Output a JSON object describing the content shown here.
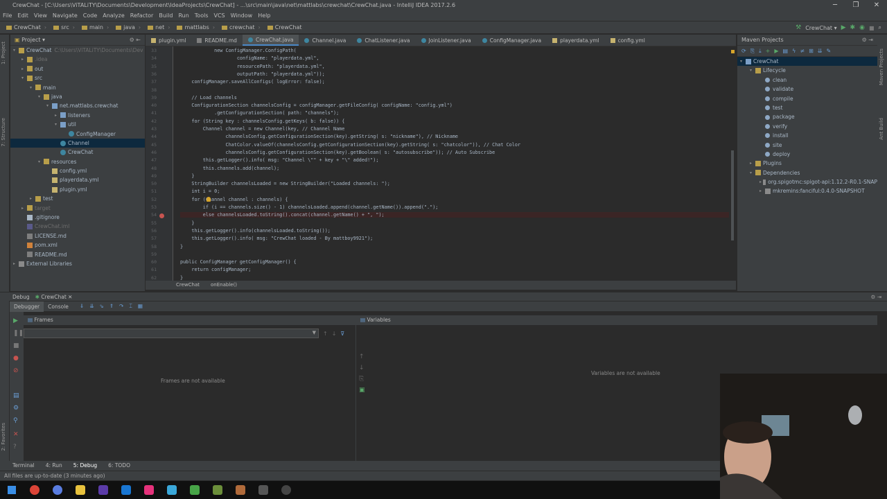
{
  "window": {
    "title": "CrewChat - [C:\\Users\\ViTALiTY\\Documents\\Development\\IdeaProjects\\CrewChat] - ...\\src\\main\\java\\net\\mattlabs\\crewchat\\CrewChat.java - IntelliJ IDEA 2017.2.6"
  },
  "menu": [
    "File",
    "Edit",
    "View",
    "Navigate",
    "Code",
    "Analyze",
    "Refactor",
    "Build",
    "Run",
    "Tools",
    "VCS",
    "Window",
    "Help"
  ],
  "nav": {
    "crumbs": [
      "CrewChat",
      "src",
      "main",
      "java",
      "net",
      "mattlabs",
      "crewchat",
      "CrewChat"
    ],
    "run_config": "CrewChat"
  },
  "left_strip": {
    "project": "1: Project",
    "structure": "7: Structure",
    "favorites": "2: Favorites"
  },
  "project": {
    "header": "Project",
    "items": [
      {
        "label": "CrewChat",
        "suffix": "C:\\Users\\ViTALiTY\\Documents\\Dev",
        "icon": "folder",
        "indent": 0,
        "arrow": "▾"
      },
      {
        "label": ".idea",
        "icon": "folder",
        "indent": 1,
        "arrow": "▸",
        "dim": true
      },
      {
        "label": "out",
        "icon": "folder",
        "indent": 1,
        "arrow": "▸"
      },
      {
        "label": "src",
        "icon": "folder",
        "indent": 1,
        "arrow": "▾"
      },
      {
        "label": "main",
        "icon": "folder",
        "indent": 2,
        "arrow": "▾"
      },
      {
        "label": "java",
        "icon": "folder",
        "indent": 3,
        "arrow": "▾"
      },
      {
        "label": "net.mattlabs.crewchat",
        "icon": "pkg",
        "indent": 4,
        "arrow": "▾"
      },
      {
        "label": "listeners",
        "icon": "pkg",
        "indent": 5,
        "arrow": "▸"
      },
      {
        "label": "util",
        "icon": "pkg",
        "indent": 5,
        "arrow": "▾"
      },
      {
        "label": "ConfigManager",
        "icon": "java",
        "indent": 6,
        "arrow": ""
      },
      {
        "label": "Channel",
        "icon": "java",
        "indent": 5,
        "arrow": "",
        "selected": true
      },
      {
        "label": "CrewChat",
        "icon": "java",
        "indent": 5,
        "arrow": ""
      },
      {
        "label": "resources",
        "icon": "folder",
        "indent": 3,
        "arrow": "▾"
      },
      {
        "label": "config.yml",
        "icon": "yml",
        "indent": 4,
        "arrow": ""
      },
      {
        "label": "playerdata.yml",
        "icon": "yml",
        "indent": 4,
        "arrow": ""
      },
      {
        "label": "plugin.yml",
        "icon": "yml",
        "indent": 4,
        "arrow": ""
      },
      {
        "label": "test",
        "icon": "folder",
        "indent": 2,
        "arrow": "▸"
      },
      {
        "label": "target",
        "icon": "folder",
        "indent": 1,
        "arrow": "▸",
        "dim": true
      },
      {
        "label": ".gitignore",
        "icon": "git",
        "indent": 1,
        "arrow": ""
      },
      {
        "label": "CrewChat.iml",
        "icon": "iml",
        "indent": 1,
        "arrow": "",
        "dim": true
      },
      {
        "label": "LICENSE.md",
        "icon": "md",
        "indent": 1,
        "arrow": ""
      },
      {
        "label": "pom.xml",
        "icon": "xml",
        "indent": 1,
        "arrow": ""
      },
      {
        "label": "README.md",
        "icon": "md",
        "indent": 1,
        "arrow": ""
      },
      {
        "label": "External Libraries",
        "icon": "lib",
        "indent": 0,
        "arrow": "▸"
      }
    ]
  },
  "tabs": [
    {
      "label": "plugin.yml",
      "type": "yml"
    },
    {
      "label": "README.md",
      "type": "md"
    },
    {
      "label": "CrewChat.java",
      "type": "java",
      "active": true
    },
    {
      "label": "Channel.java",
      "type": "java"
    },
    {
      "label": "ChatListener.java",
      "type": "java"
    },
    {
      "label": "JoinListener.java",
      "type": "java"
    },
    {
      "label": "ConfigManager.java",
      "type": "java"
    },
    {
      "label": "playerdata.yml",
      "type": "yml"
    },
    {
      "label": "config.yml",
      "type": "yml"
    }
  ],
  "code": [
    {
      "ln": "33",
      "text": "            new ConfigManager.ConfigPath("
    },
    {
      "ln": "34",
      "text": "                    configName: \"playerdata.yml\","
    },
    {
      "ln": "35",
      "text": "                    resourcePath: \"playerdata.yml\","
    },
    {
      "ln": "36",
      "text": "                    outputPath: \"playerdata.yml\"));"
    },
    {
      "ln": "37",
      "text": "    configManager.saveAllConfigs( logError: false);"
    },
    {
      "ln": "38",
      "text": ""
    },
    {
      "ln": "39",
      "text": "    // Load channels"
    },
    {
      "ln": "40",
      "text": "    ConfigurationSection channelsConfig = configManager.getFileConfig( configName: \"config.yml\")"
    },
    {
      "ln": "41",
      "text": "            .getConfigurationSection( path: \"channels\");"
    },
    {
      "ln": "42",
      "text": "    for (String key : channelsConfig.getKeys( b: false)) {"
    },
    {
      "ln": "43",
      "text": "        Channel channel = new Channel(key, // Channel Name"
    },
    {
      "ln": "44",
      "text": "                channelsConfig.getConfigurationSection(key).getString( s: \"nickname\"), // Nickname"
    },
    {
      "ln": "45",
      "text": "                ChatColor.valueOf(channelsConfig.getConfigurationSection(key).getString( s: \"chatcolor\")), // Chat Color"
    },
    {
      "ln": "46",
      "text": "                channelsConfig.getConfigurationSection(key).getBoolean( s: \"autosubscribe\")); // Auto Subscribe"
    },
    {
      "ln": "47",
      "text": "        this.getLogger().info( msg: \"Channel \\\"\" + key + \"\\\" added!\");"
    },
    {
      "ln": "48",
      "text": "        this.channels.add(channel);"
    },
    {
      "ln": "49",
      "text": "    }"
    },
    {
      "ln": "50",
      "text": "    StringBuilder channelsLoaded = new StringBuilder(\"Loaded channels: \");"
    },
    {
      "ln": "51",
      "text": "    int i = 0;"
    },
    {
      "ln": "52",
      "text": "    for (Channel channel : channels) {"
    },
    {
      "ln": "53",
      "text": "        if (i == channels.size() - 1) channelsLoaded.append(channel.getName()).append(\".\");"
    },
    {
      "ln": "54",
      "text": "        else channelsLoaded.toString().concat(channel.getName() + \", \");",
      "highlight": true
    },
    {
      "ln": "55",
      "text": "    }"
    },
    {
      "ln": "56",
      "text": "    this.getLogger().info(channelsLoaded.toString());"
    },
    {
      "ln": "57",
      "text": "    this.getLogger().info( msg: \"CrewChat loaded - By mattboy9921\");"
    },
    {
      "ln": "58",
      "text": "}"
    },
    {
      "ln": "59",
      "text": ""
    },
    {
      "ln": "60",
      "text": "public ConfigManager getConfigManager() {"
    },
    {
      "ln": "61",
      "text": "    return configManager;"
    },
    {
      "ln": "62",
      "text": "}"
    }
  ],
  "editor_breadcrumb": [
    "CrewChat",
    "onEnable()"
  ],
  "maven": {
    "header": "Maven Projects",
    "items": [
      {
        "label": "CrewChat",
        "indent": 0,
        "arrow": "▾",
        "icon": "pkg"
      },
      {
        "label": "Lifecycle",
        "indent": 1,
        "arrow": "▾",
        "icon": "folder"
      },
      {
        "label": "clean",
        "indent": 2,
        "arrow": "",
        "icon": "gear"
      },
      {
        "label": "validate",
        "indent": 2,
        "arrow": "",
        "icon": "gear"
      },
      {
        "label": "compile",
        "indent": 2,
        "arrow": "",
        "icon": "gear"
      },
      {
        "label": "test",
        "indent": 2,
        "arrow": "",
        "icon": "gear"
      },
      {
        "label": "package",
        "indent": 2,
        "arrow": "",
        "icon": "gear"
      },
      {
        "label": "verify",
        "indent": 2,
        "arrow": "",
        "icon": "gear"
      },
      {
        "label": "install",
        "indent": 2,
        "arrow": "",
        "icon": "gear"
      },
      {
        "label": "site",
        "indent": 2,
        "arrow": "",
        "icon": "gear"
      },
      {
        "label": "deploy",
        "indent": 2,
        "arrow": "",
        "icon": "gear"
      },
      {
        "label": "Plugins",
        "indent": 1,
        "arrow": "▸",
        "icon": "folder"
      },
      {
        "label": "Dependencies",
        "indent": 1,
        "arrow": "▾",
        "icon": "folder"
      },
      {
        "label": "org.spigotmc:spigot-api:1.12.2-R0.1-SNAP",
        "indent": 2,
        "arrow": "▸",
        "icon": "lib"
      },
      {
        "label": "mkremins:fanciful:0.4.0-SNAPSHOT",
        "indent": 2,
        "arrow": "▸",
        "icon": "lib"
      }
    ]
  },
  "debug": {
    "label": "Debug",
    "config": "CrewChat",
    "tab_debugger": "Debugger",
    "tab_console": "Console",
    "frames_header": "Frames",
    "frames_empty": "Frames are not available",
    "variables_header": "Variables",
    "variables_empty": "Variables are not available"
  },
  "bottom_tabs": [
    "Terminal",
    "4: Run",
    "5: Debug",
    "6: TODO"
  ],
  "status": "All files are up-to-date (3 minutes ago)",
  "colors": {
    "accent": "#4a88c7",
    "breakpoint": "#c75450",
    "background": "#2b2b2b",
    "panel": "#3c3f41"
  }
}
